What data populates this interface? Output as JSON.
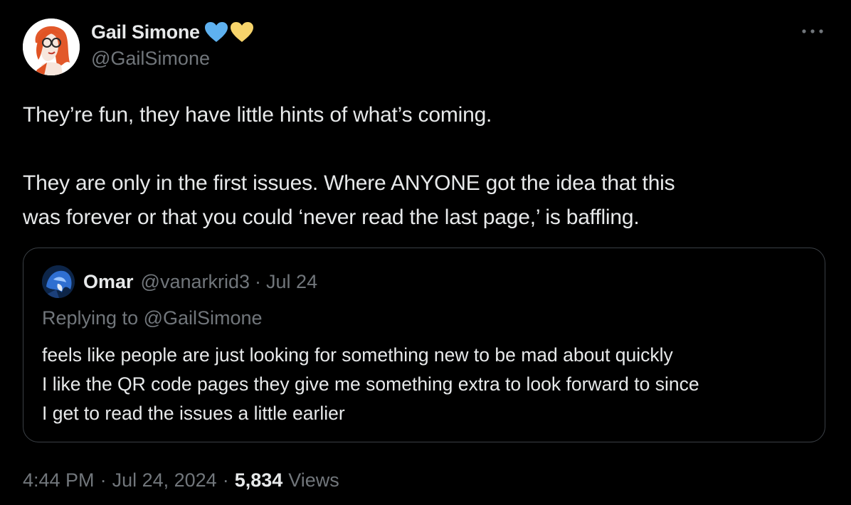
{
  "tweet": {
    "author": {
      "display_name": "Gail Simone",
      "handle": "@GailSimone",
      "avatar_icon": "cartoon-redhead-avatar-icon",
      "badges": [
        "blue-heart-icon",
        "yellow-heart-icon"
      ]
    },
    "more_icon": "ellipsis-icon",
    "body": {
      "line1": "They’re fun, they have little hints of what’s coming.",
      "line2": "They are only in the first issues.  Where ANYONE got the idea that this",
      "line3": "was forever or that you could ‘never read the last page,’ is baffling."
    },
    "quoted": {
      "display_name": "Omar",
      "handle": "@vanarkrid3",
      "separator": "·",
      "date": "Jul 24",
      "replying_to": "Replying to @GailSimone",
      "text": {
        "line1": "feels like people are just looking for something new to be mad about quickly",
        "line2": "I like the QR code pages they give me something extra to look forward to since",
        "line3": "I get to read the issues a little earlier"
      }
    },
    "meta": {
      "time": "4:44 PM",
      "separator": "·",
      "date": "Jul 24, 2024",
      "views_count": "5,834",
      "views_label": "Views"
    }
  },
  "colors": {
    "background": "#000000",
    "primary_text": "#e7e9ea",
    "secondary_text": "#71767b",
    "border": "#3b4046",
    "heart_blue": "#5eb1ef",
    "heart_yellow": "#f7d46b"
  }
}
